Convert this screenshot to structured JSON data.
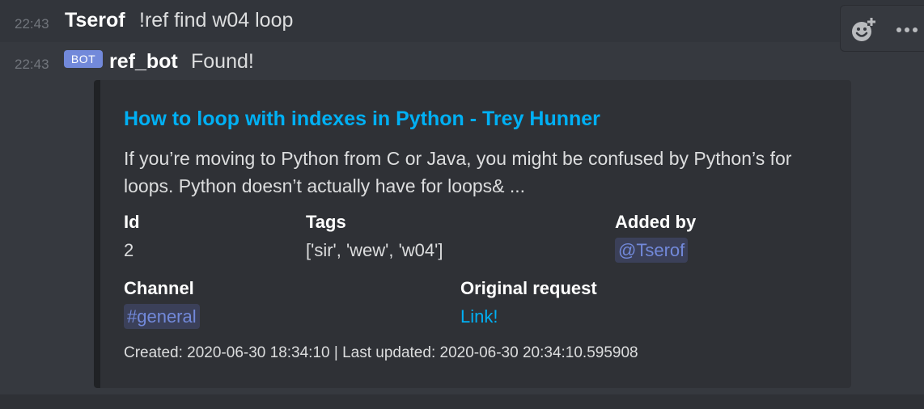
{
  "messages": [
    {
      "time": "22:43",
      "author": "Tserof",
      "content": "!ref find w04 loop"
    },
    {
      "time": "22:43",
      "badge": "BOT",
      "author": "ref_bot",
      "content": "Found!"
    }
  ],
  "toolbar": {
    "react_icon": "add-reaction-icon",
    "more_icon": "more-options-icon"
  },
  "embed": {
    "title": "How to loop with indexes in Python - Trey Hunner",
    "description": "If you’re moving to Python from C or Java, you might be confused by Python’s for loops. Python doesn’t actually have for loops& ...",
    "fields": {
      "id": {
        "name": "Id",
        "value": "2"
      },
      "tags": {
        "name": "Tags",
        "value": "['sir', 'wew', 'w04']"
      },
      "added_by": {
        "name": "Added by",
        "value": "@Tserof"
      },
      "channel": {
        "name": "Channel",
        "value": "#general"
      },
      "original_request": {
        "name": "Original request",
        "value": "Link!"
      }
    },
    "footer": "Created: 2020-06-30 18:34:10 | Last updated: 2020-06-30 20:34:10.595908",
    "colors": {
      "title": "#00b0f4",
      "mention_text": "#7289da",
      "mention_bg": "#3b4059",
      "background": "#2f3136"
    }
  }
}
